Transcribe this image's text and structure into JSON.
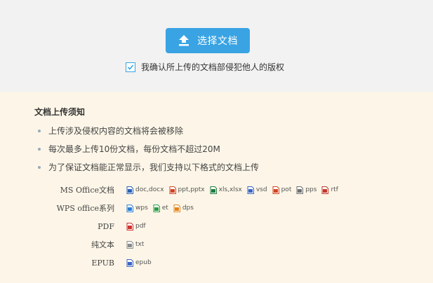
{
  "upload": {
    "button_label": "选择文档",
    "confirm_checked": true,
    "confirm_text": "我确认所上传的文档部侵犯他人的版权"
  },
  "notice": {
    "title": "文档上传须知",
    "items": [
      "上传涉及侵权内容的文档将会被移除",
      "每次最多上传10份文档，每份文档不超过20M",
      "为了保证文档能正常显示，我们支持以下格式的文档上传"
    ]
  },
  "formats": [
    {
      "name": "MS Office文档",
      "types": [
        {
          "label": "doc,docx",
          "icon": "word-file-icon",
          "color": "#2b5fb4"
        },
        {
          "label": "ppt,pptx",
          "icon": "powerpoint-file-icon",
          "color": "#d04423"
        },
        {
          "label": "xls,xlsx",
          "icon": "excel-file-icon",
          "color": "#1f7a3e"
        },
        {
          "label": "vsd",
          "icon": "visio-file-icon",
          "color": "#3a66c4"
        },
        {
          "label": "pot",
          "icon": "potx-file-icon",
          "color": "#d04423"
        },
        {
          "label": "pps",
          "icon": "pps-file-icon",
          "color": "#6f6f6f"
        },
        {
          "label": "rtf",
          "icon": "rtf-file-icon",
          "color": "#c0392b"
        }
      ]
    },
    {
      "name": "WPS office系列",
      "types": [
        {
          "label": "wps",
          "icon": "wps-file-icon",
          "color": "#2b7fd3"
        },
        {
          "label": "et",
          "icon": "et-file-icon",
          "color": "#2d9b45"
        },
        {
          "label": "dps",
          "icon": "dps-file-icon",
          "color": "#e3841d"
        }
      ]
    },
    {
      "name": "PDF",
      "types": [
        {
          "label": "pdf",
          "icon": "pdf-file-icon",
          "color": "#d0302b"
        }
      ]
    },
    {
      "name": "纯文本",
      "types": [
        {
          "label": "txt",
          "icon": "txt-file-icon",
          "color": "#8a8a8a"
        }
      ]
    },
    {
      "name": "EPUB",
      "types": [
        {
          "label": "epub",
          "icon": "epub-file-icon",
          "color": "#3a66c4"
        }
      ]
    }
  ]
}
